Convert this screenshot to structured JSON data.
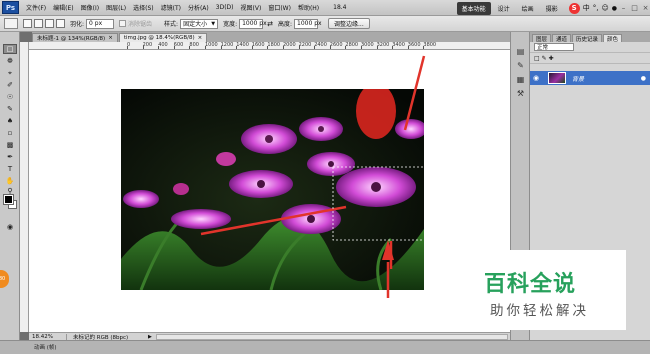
{
  "app": {
    "logo": "Ps",
    "menus": [
      "文件(F)",
      "编辑(E)",
      "图像(I)",
      "图层(L)",
      "选择(S)",
      "滤镜(T)",
      "分析(A)",
      "3D(D)",
      "视图(V)",
      "窗口(W)",
      "帮助(H)"
    ],
    "zoom_preset": "18.4",
    "workspaces": {
      "basic": "基本功能",
      "design": "设计",
      "paint": "绘画",
      "photo": "摄影"
    },
    "ime": {
      "lang": "中",
      "punct": "°,"
    }
  },
  "options_bar": {
    "feather_label": "羽化:",
    "feather_value": "0 px",
    "antialias_label": "消除锯齿",
    "style_label": "样式:",
    "style_value": "固定大小",
    "width_label": "宽度:",
    "width_value": "1000 px",
    "height_label": "高度:",
    "height_value": "1000 px",
    "refine_edge": "调整边缘..."
  },
  "tabs": [
    {
      "label": "未标题-1 @ 134%(RGB/8)",
      "close": "×",
      "active": false
    },
    {
      "label": "timg.jpg @ 18.4%(RGB/8)",
      "close": "×",
      "active": true
    }
  ],
  "ruler": {
    "labels": [
      "0",
      "200",
      "400",
      "600",
      "800",
      "1000",
      "1200",
      "1400",
      "1600",
      "1800",
      "2000",
      "2200",
      "2400",
      "2600",
      "2800",
      "3000",
      "3200",
      "3400",
      "3600",
      "3800"
    ]
  },
  "status": {
    "zoom": "18.42%",
    "doc_info": "未标记的 RGB (8bpc)",
    "bottom_label": "动画 (帧)"
  },
  "panel": {
    "tabs": [
      "图层",
      "通道",
      "历史记录",
      "颜色"
    ],
    "blend_mode": "正常",
    "layer_name": "背景"
  },
  "watermark": {
    "main": "百科全说",
    "sub": "助你轻松解决"
  },
  "side_badge": "80"
}
